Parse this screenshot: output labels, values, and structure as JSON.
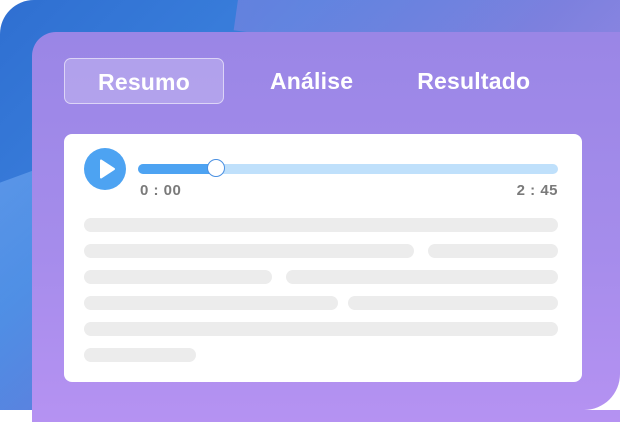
{
  "tabs": [
    {
      "label": "Resumo",
      "active": true
    },
    {
      "label": "Análise",
      "active": false
    },
    {
      "label": "Resultado",
      "active": false
    }
  ],
  "player": {
    "current_time": "0 : 00",
    "total_time": "2 : 45",
    "progress_fraction": 0.185,
    "play_icon": "play-icon"
  },
  "colors": {
    "accent": "#4da3f2",
    "track": "#bfe0fb",
    "panel": "#a58ceb",
    "text_placeholder": "#ececec"
  }
}
